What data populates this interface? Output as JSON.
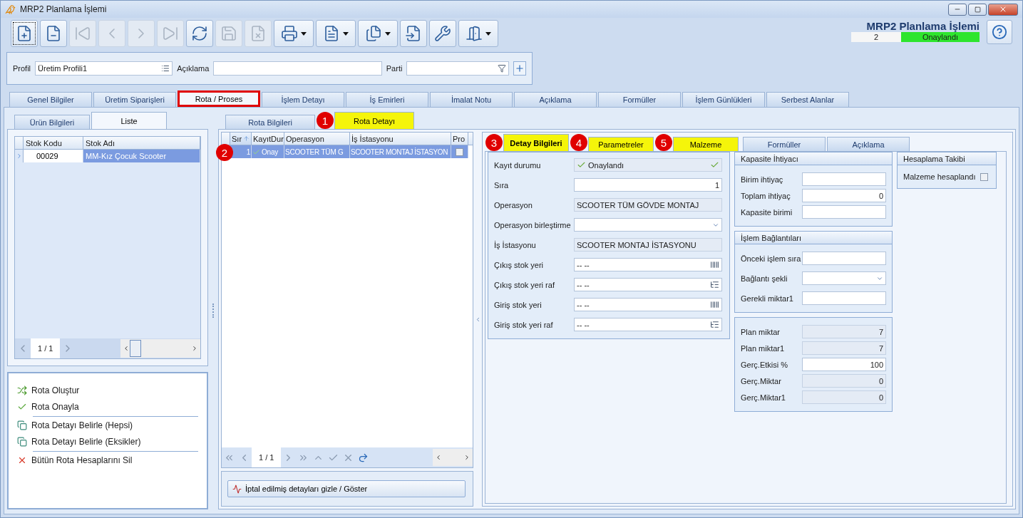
{
  "window": {
    "title": "MRP2 Planlama İşlemi"
  },
  "toolbar": [
    {
      "kind": "new",
      "disabled": false,
      "dropdown": false,
      "focused": true
    },
    {
      "kind": "delete",
      "disabled": false,
      "dropdown": false,
      "focused": false
    },
    {
      "kind": "first",
      "disabled": true,
      "dropdown": false,
      "focused": false
    },
    {
      "kind": "prev",
      "disabled": true,
      "dropdown": false,
      "focused": false
    },
    {
      "kind": "next",
      "disabled": true,
      "dropdown": false,
      "focused": false
    },
    {
      "kind": "last",
      "disabled": true,
      "dropdown": false,
      "focused": false
    },
    {
      "kind": "refresh",
      "disabled": false,
      "dropdown": false,
      "focused": false
    },
    {
      "kind": "save",
      "disabled": true,
      "dropdown": false,
      "focused": false
    },
    {
      "kind": "discard",
      "disabled": true,
      "dropdown": false,
      "focused": false
    },
    {
      "kind": "print",
      "disabled": false,
      "dropdown": true,
      "focused": false
    },
    {
      "kind": "pdf",
      "disabled": false,
      "dropdown": true,
      "focused": false
    },
    {
      "kind": "export",
      "disabled": false,
      "dropdown": true,
      "focused": false
    },
    {
      "kind": "import",
      "disabled": false,
      "dropdown": false,
      "focused": false
    },
    {
      "kind": "tools",
      "disabled": false,
      "dropdown": false,
      "focused": false
    },
    {
      "kind": "exit",
      "disabled": false,
      "dropdown": true,
      "focused": false
    }
  ],
  "header": {
    "title": "MRP2 Planlama İşlemi",
    "number": "2",
    "status": "Onaylandı"
  },
  "filter": [
    {
      "label": "Profil",
      "value": "Üretim Profili1",
      "kind": "list"
    },
    {
      "label": "Açıklama",
      "kind": "text"
    },
    {
      "label": "Parti",
      "kind": "lookup"
    }
  ],
  "main_tabs": [
    {
      "label": "Genel Bilgiler",
      "selected": false,
      "outlined": false
    },
    {
      "label": "Üretim Siparişleri",
      "selected": false,
      "outlined": false
    },
    {
      "label": "Rota / Proses",
      "selected": true,
      "outlined": true
    },
    {
      "label": "İşlem Detayı",
      "selected": false,
      "outlined": false
    },
    {
      "label": "İş Emirleri",
      "selected": false,
      "outlined": false
    },
    {
      "label": "İmalat Notu",
      "selected": false,
      "outlined": false
    },
    {
      "label": "Açıklama",
      "selected": false,
      "outlined": false
    },
    {
      "label": "Formüller",
      "selected": false,
      "outlined": false
    },
    {
      "label": "İşlem Günlükleri",
      "selected": false,
      "outlined": false
    },
    {
      "label": "Serbest Alanlar",
      "selected": false,
      "outlined": false
    }
  ],
  "left_tabs": [
    {
      "label": "Ürün Bilgileri",
      "selected": false
    },
    {
      "label": "Liste",
      "selected": true
    }
  ],
  "product_grid": {
    "columns": [
      "Stok Kodu",
      "Stok Adı"
    ],
    "rows": [
      {
        "cells": [
          "00029",
          "MM-Kız Çocuk Scooter"
        ],
        "selected": true
      }
    ],
    "pager": "1 / 1"
  },
  "actions": [
    {
      "label": "Rota Oluştur",
      "kind": "create",
      "divider_after": false
    },
    {
      "label": "Rota Onayla",
      "kind": "approve",
      "divider_after": true
    },
    {
      "label": "Rota Detayı Belirle (Hepsi)",
      "kind": "detail",
      "divider_after": false
    },
    {
      "label": "Rota Detayı Belirle (Eksikler)",
      "kind": "detail",
      "divider_after": true
    },
    {
      "label": "Bütün Rota Hesaplarını Sil",
      "kind": "delete",
      "divider_after": false
    }
  ],
  "center_tabs": [
    {
      "label": "Rota Bilgileri",
      "selected": false,
      "highlighted": false
    },
    {
      "label": "Rota Detayı",
      "selected": true,
      "highlighted": true,
      "callout": "1"
    }
  ],
  "route_grid": {
    "columns": [
      {
        "label": "Sır",
        "sorted": true
      },
      {
        "label": "KayıtDur",
        "sorted": false
      },
      {
        "label": "Operasyon",
        "sorted": false
      },
      {
        "label": "İş İstasyonu",
        "sorted": false
      },
      {
        "label": "Pro",
        "sorted": false
      }
    ],
    "rows": [
      {
        "sira": "1",
        "status": "Onay",
        "operation": "SCOOTER TÜM G",
        "station": "SCOOTER MONTAJ İSTASYON",
        "pro_checked": false,
        "selected": true,
        "callout": "2"
      }
    ],
    "pager": "1 / 1"
  },
  "toggle_button": "İptal edilmiş detayları gizle / Göster",
  "detail_tabs": [
    {
      "label": "Detay Bilgileri",
      "selected": true,
      "highlighted": true,
      "callout": "3"
    },
    {
      "label": "Parametreler",
      "selected": false,
      "highlighted": true,
      "callout": "4"
    },
    {
      "label": "Malzeme",
      "selected": false,
      "highlighted": true,
      "callout": "5"
    },
    {
      "label": "Formüller",
      "selected": false,
      "highlighted": false
    },
    {
      "label": "Açıklama",
      "selected": false,
      "highlighted": false
    }
  ],
  "detail_fields": [
    {
      "label": "Kayıt durumu",
      "value": "Onaylandı",
      "kind": "status"
    },
    {
      "label": "Sıra",
      "value": "1",
      "kind": "number"
    },
    {
      "label": "Operasyon",
      "value": "SCOOTER TÜM GÖVDE MONTAJ",
      "kind": "readonly"
    },
    {
      "label": "Operasyon birleştirme",
      "kind": "dropdown"
    },
    {
      "label": "İş İstasyonu",
      "value": "SCOOTER MONTAJ İSTASYONU",
      "kind": "readonly"
    },
    {
      "label": "Çıkış stok yeri",
      "value": "-- --",
      "kind": "barcode"
    },
    {
      "label": "Çıkış stok yeri raf",
      "value": "-- --",
      "kind": "tree"
    },
    {
      "label": "Giriş stok yeri",
      "value": "-- --",
      "kind": "barcode"
    },
    {
      "label": "Giriş stok yeri raf",
      "value": "-- --",
      "kind": "tree"
    }
  ],
  "capacity": {
    "title": "Kapasite İhtiyacı",
    "fields": [
      {
        "label": "Birim ihtiyaç",
        "kind": "number"
      },
      {
        "label": "Toplam ihtiyaç",
        "value": "0",
        "kind": "number"
      },
      {
        "label": "Kapasite birimi",
        "kind": "text"
      }
    ]
  },
  "connections": {
    "title": "İşlem Bağlantıları",
    "fields": [
      {
        "label": "Önceki işlem sıra",
        "kind": "number"
      },
      {
        "label": "Bağlantı şekli",
        "kind": "dropdown"
      },
      {
        "label": "Gerekli miktar1",
        "kind": "number"
      }
    ]
  },
  "quantities": {
    "fields": [
      {
        "label": "Plan miktar",
        "value": "7",
        "kind": "readonly_number"
      },
      {
        "label": "Plan miktar1",
        "value": "7",
        "kind": "readonly_number"
      },
      {
        "label": "Gerç.Etkisi %",
        "value": "100",
        "kind": "number"
      },
      {
        "label": "Gerç.Miktar",
        "value": "0",
        "kind": "readonly_number"
      },
      {
        "label": "Gerç.Miktar1",
        "value": "0",
        "kind": "readonly_number"
      }
    ]
  },
  "tracking": {
    "title": "Hesaplama Takibi",
    "label": "Malzeme hesaplandı",
    "checked": false
  }
}
